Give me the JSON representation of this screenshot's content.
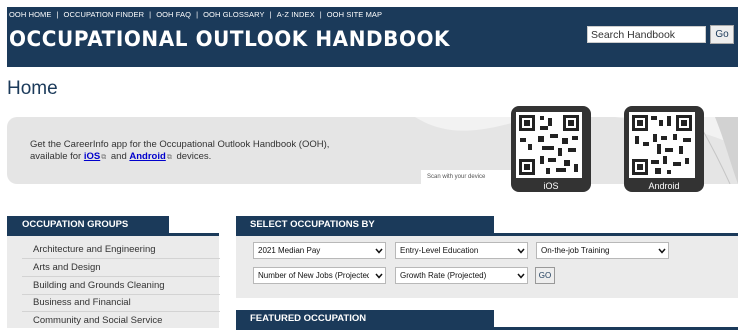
{
  "header": {
    "nav": [
      "OOH HOME",
      "OCCUPATION FINDER",
      "OOH FAQ",
      "OOH GLOSSARY",
      "A-Z INDEX",
      "OOH SITE MAP"
    ],
    "title": "OCCUPATIONAL OUTLOOK HANDBOOK",
    "search_value": "Search Handbook",
    "search_button": "Go"
  },
  "page_title": "Home",
  "promo": {
    "line1": "Get the CareerInfo app for the Occupational Outlook Handbook (OOH),",
    "line2_prefix": "available for",
    "ios_link": "iOS",
    "and": "and",
    "android_link": "Android",
    "line2_suffix": "devices.",
    "scan_label": "Scan with your device",
    "ios_label": "iOS",
    "android_label": "Android"
  },
  "occupation_groups": {
    "heading": "OCCUPATION GROUPS",
    "items": [
      "Architecture and Engineering",
      "Arts and Design",
      "Building and Grounds Cleaning",
      "Business and Financial",
      "Community and Social Service"
    ]
  },
  "select_by": {
    "heading": "SELECT OCCUPATIONS BY",
    "dropdowns": [
      "2021 Median Pay",
      "Entry-Level Education",
      "On-the-job Training",
      "Number of New Jobs (Projected)",
      "Growth Rate (Projected)"
    ],
    "go_button": "GO"
  },
  "featured": {
    "heading": "FEATURED OCCUPATION"
  },
  "colors": {
    "navy": "#1b3a5a",
    "link": "#0000cc",
    "panel": "#ebebeb"
  },
  "icons": [
    "external-link-icon",
    "chevron-down-icon",
    "qr-code-icon"
  ]
}
